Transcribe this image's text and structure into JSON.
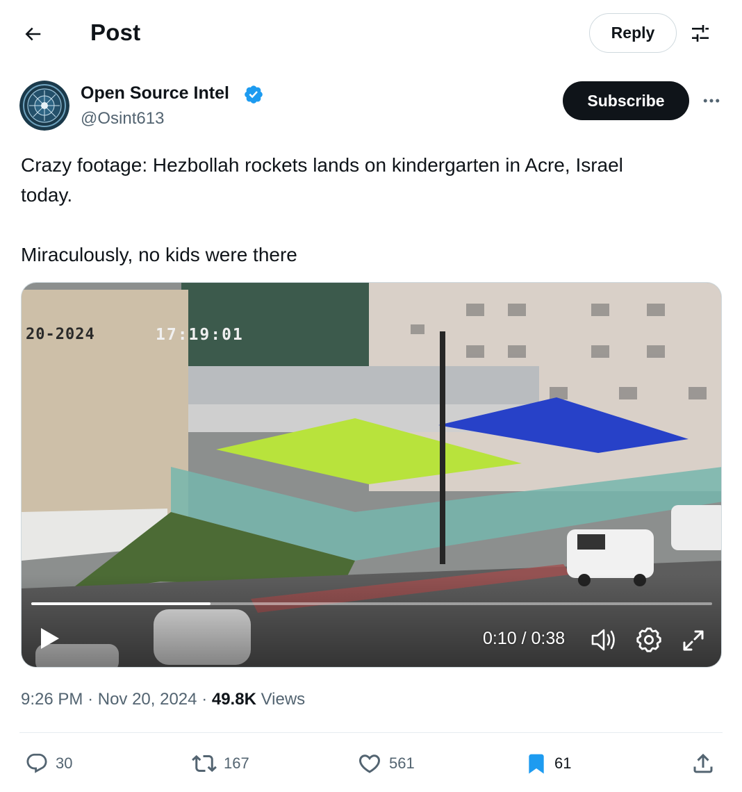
{
  "header": {
    "title": "Post",
    "reply_label": "Reply",
    "back_icon": "arrow-left-icon",
    "filter_icon": "sliders-icon"
  },
  "author": {
    "name": "Open Source Intel",
    "handle": "@Osint613",
    "verified": true,
    "subscribe_label": "Subscribe",
    "more_icon": "more-horizontal-icon"
  },
  "tweet": {
    "line1": "Crazy footage: Hezbollah rockets lands on kindergarten in Acre, Israel",
    "line2": "today.",
    "line3": "Miraculously, no kids were there"
  },
  "video": {
    "overlay_date": "20-2024",
    "overlay_time": "17:19:01",
    "current_time": "0:10",
    "duration": "0:38",
    "time_display": "0:10 / 0:38",
    "progress": 0.263
  },
  "meta": {
    "time": "9:26 PM",
    "separator": "·",
    "date": "Nov 20, 2024",
    "views_count": "49.8K",
    "views_label": "Views"
  },
  "actions": {
    "replies": "30",
    "reposts": "167",
    "likes": "561",
    "bookmarks": "61"
  },
  "colors": {
    "text": "#0f1419",
    "secondary": "#536471",
    "verified": "#1d9bf0",
    "bookmark_active": "#1d9bf0"
  }
}
